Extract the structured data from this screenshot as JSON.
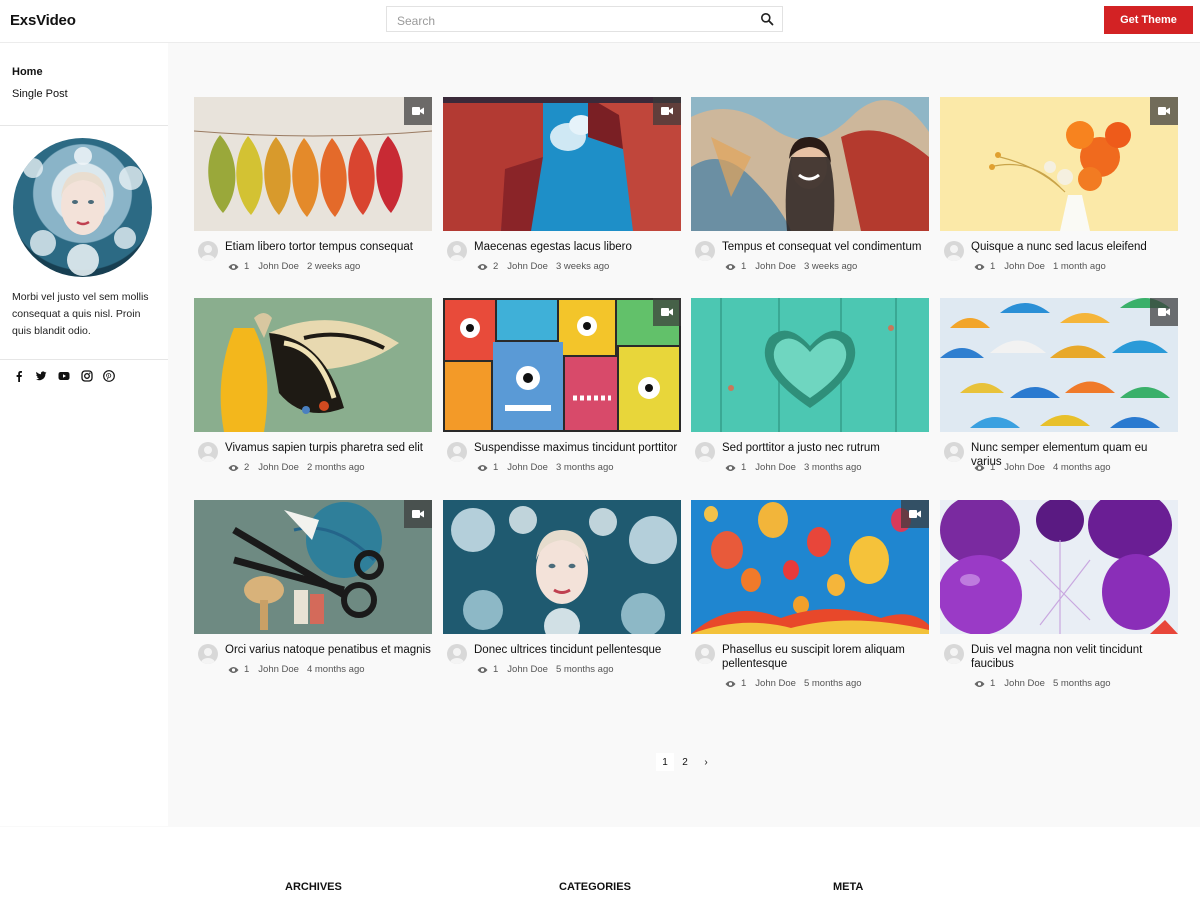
{
  "header": {
    "logo": "ExsVideo",
    "search_placeholder": "Search",
    "search_value": "",
    "cta_label": "Get Theme",
    "cta_color": "#d32224"
  },
  "sidebar": {
    "nav": [
      {
        "label": "Home",
        "active": true
      },
      {
        "label": "Single Post",
        "active": false
      }
    ],
    "bio": "Morbi vel justo vel sem mollis consequat a quis nisl. Proin quis blandit odio.",
    "social_icons": [
      "facebook-icon",
      "twitter-icon",
      "youtube-icon",
      "instagram-icon",
      "pinterest-icon"
    ]
  },
  "posts": [
    {
      "title": "Etiam libero tortor tempus consequat",
      "views": "1",
      "author": "John Doe",
      "date": "2 weeks ago",
      "video": true,
      "thumb": "autumn-leaves"
    },
    {
      "title": "Maecenas egestas lacus libero",
      "views": "2",
      "author": "John Doe",
      "date": "3 weeks ago",
      "video": true,
      "thumb": "red-buildings-sky"
    },
    {
      "title": "Tempus et consequat vel condimentum",
      "views": "1",
      "author": "John Doe",
      "date": "3 weeks ago",
      "video": false,
      "thumb": "graffiti-woman"
    },
    {
      "title": "Quisque a nunc sed lacus eleifend",
      "views": "1",
      "author": "John Doe",
      "date": "1 month ago",
      "video": true,
      "thumb": "orange-flowers"
    },
    {
      "title": "Vivamus sapien turpis pharetra sed elit",
      "views": "2",
      "author": "John Doe",
      "date": "2 months ago",
      "video": false,
      "thumb": "butterfly"
    },
    {
      "title": "Suspendisse maximus tincidunt porttitor",
      "views": "1",
      "author": "John Doe",
      "date": "3 months ago",
      "video": true,
      "thumb": "monster-graffiti"
    },
    {
      "title": "Sed porttitor a justo nec rutrum",
      "views": "1",
      "author": "John Doe",
      "date": "3 months ago",
      "video": false,
      "thumb": "green-heart"
    },
    {
      "title": "Nunc semper elementum quam eu varius",
      "views": "1",
      "author": "John Doe",
      "date": "4 months ago",
      "video": true,
      "thumb": "umbrellas"
    },
    {
      "title": "Orci varius natoque penatibus et magnis",
      "views": "1",
      "author": "John Doe",
      "date": "4 months ago",
      "video": true,
      "thumb": "sewing-tools"
    },
    {
      "title": "Donec ultrices tincidunt pellentesque",
      "views": "1",
      "author": "John Doe",
      "date": "5 months ago",
      "video": false,
      "thumb": "woman-flowers"
    },
    {
      "title": "Phasellus eu suscipit lorem aliquam pellentesque",
      "views": "1",
      "author": "John Doe",
      "date": "5 months ago",
      "video": true,
      "thumb": "hot-air-balloons"
    },
    {
      "title": "Duis vel magna non velit tincidunt faucibus",
      "views": "1",
      "author": "John Doe",
      "date": "5 months ago",
      "video": false,
      "thumb": "purple-balloons"
    }
  ],
  "pagination": {
    "pages": [
      "1",
      "2"
    ],
    "current": "1",
    "next": "›"
  },
  "footer": {
    "headings": [
      "ARCHIVES",
      "CATEGORIES",
      "META"
    ]
  }
}
